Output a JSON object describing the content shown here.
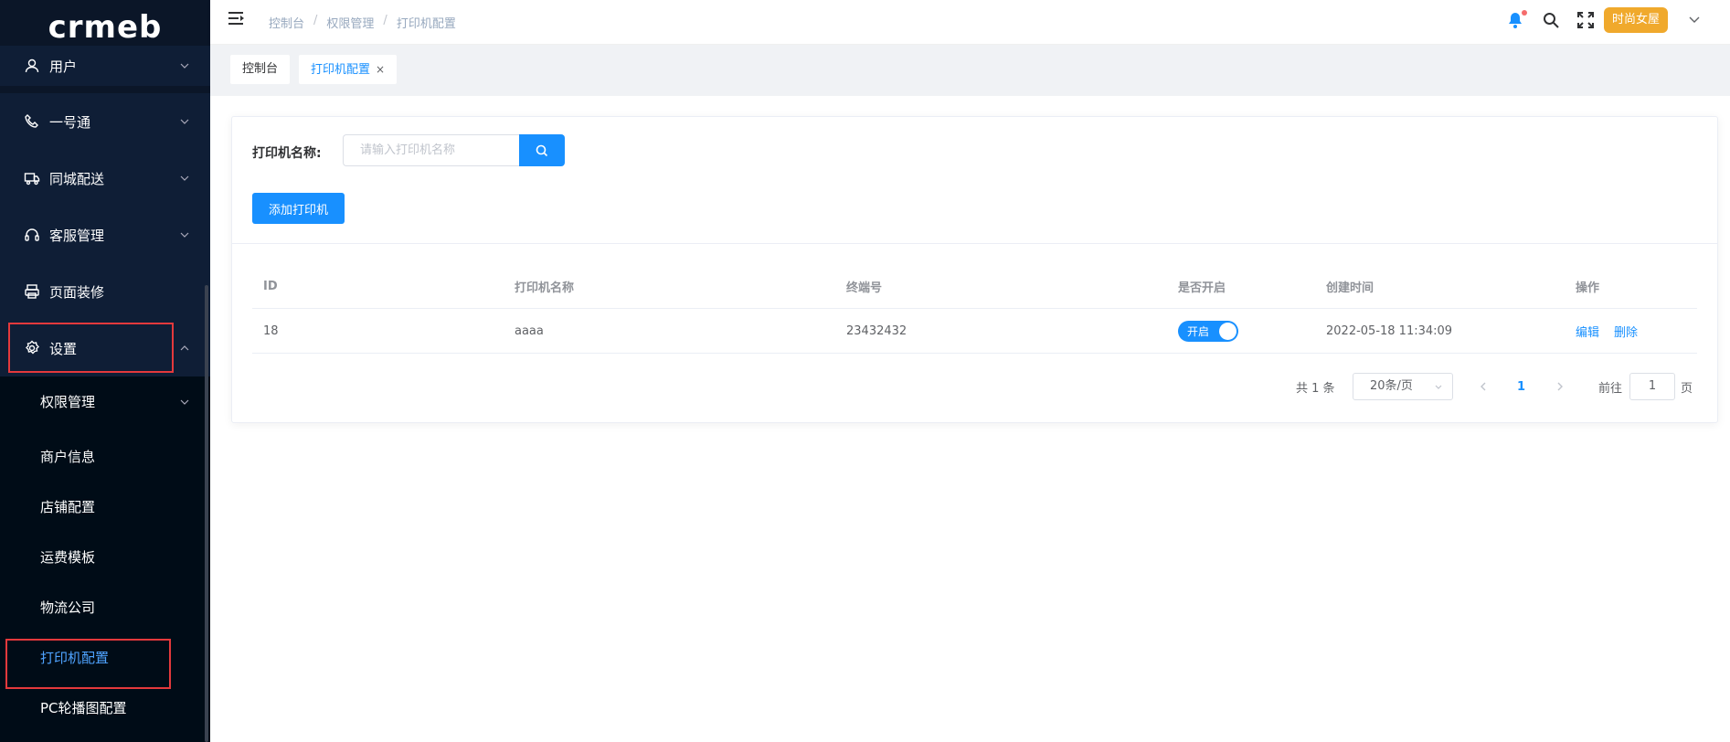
{
  "logo": "crmeb",
  "sidebar": {
    "items": [
      {
        "label": "用户",
        "icon": "user-icon"
      },
      {
        "label": "一号通",
        "icon": "phone-icon"
      },
      {
        "label": "同城配送",
        "icon": "truck-icon"
      },
      {
        "label": "客服管理",
        "icon": "headset-icon"
      },
      {
        "label": "页面装修",
        "icon": "printer-page-icon"
      },
      {
        "label": "设置",
        "icon": "gear-icon"
      }
    ],
    "sub_items": [
      {
        "label": "权限管理"
      },
      {
        "label": "商户信息"
      },
      {
        "label": "店铺配置"
      },
      {
        "label": "运费模板"
      },
      {
        "label": "物流公司"
      },
      {
        "label": "打印机配置"
      },
      {
        "label": "PC轮播图配置"
      }
    ]
  },
  "header": {
    "breadcrumb": [
      "控制台",
      "权限管理",
      "打印机配置"
    ],
    "separator": "/",
    "user_name": "时尚女屋"
  },
  "tabs": [
    {
      "label": "控制台"
    },
    {
      "label": "打印机配置",
      "close": "×"
    }
  ],
  "search": {
    "label": "打印机名称:",
    "placeholder": "请输入打印机名称",
    "value": ""
  },
  "add_button": "添加打印机",
  "table": {
    "headers": [
      "ID",
      "打印机名称",
      "终端号",
      "是否开启",
      "创建时间",
      "操作"
    ],
    "rows": [
      {
        "id": "18",
        "name": "aaaa",
        "terminal": "23432432",
        "enabled_label": "开启",
        "created": "2022-05-18 11:34:09",
        "edit": "编辑",
        "delete": "删除"
      }
    ]
  },
  "pagination": {
    "total": "共 1 条",
    "page_size": "20条/页",
    "current_page": "1",
    "goto_label": "前往",
    "goto_value": "1",
    "page_unit": "页"
  },
  "colors": {
    "primary": "#1890ff",
    "sidebar_bg": "#0b1628",
    "highlight_border": "#e4393c",
    "user_badge": "#f0a92c"
  }
}
